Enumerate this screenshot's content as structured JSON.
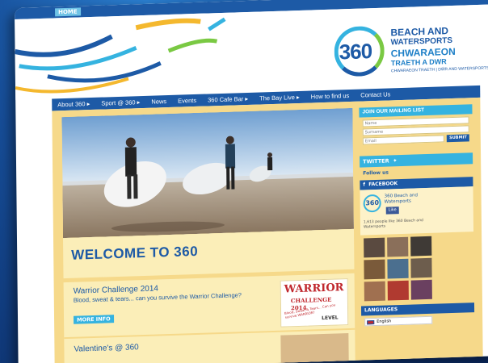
{
  "topbar": {
    "home": "HOME"
  },
  "logo": {
    "number": "360",
    "line1": "BEACH AND",
    "line2": "WATERSPORTS",
    "line3": "CHWARAEON",
    "line4": "TRAETH A DWR",
    "line5": "CHWARAEON TRAETH | DŴR AND WATERSPORTS"
  },
  "nav": {
    "items": [
      "About 360 ▸",
      "Sport @ 360 ▸",
      "News",
      "Events",
      "360 Cafe Bar ▸",
      "The Bay Live ▸",
      "How to find us",
      "Contact Us"
    ]
  },
  "main": {
    "welcome": "WELCOME TO 360",
    "news": [
      {
        "title": "Warrior Challenge 2014",
        "desc": "Blood, sweat & tears... can you survive the Warrior Challenge?",
        "more": "MORE INFO",
        "badge": {
          "title": "WARRIOR",
          "sub": "CHALLENGE 2014",
          "tag": "Blood, Sweat & Tears... Can you survive WARRIOR?",
          "brand": "LEVEL"
        }
      },
      {
        "title": "Valentine's @ 360"
      }
    ]
  },
  "sidebar": {
    "mailing_title": "JOIN OUR MAILING LIST",
    "name_placeholder": "Name",
    "surname_placeholder": "Surname",
    "email_placeholder": "Email",
    "submit": "SUBMIT",
    "twitter": "TWITTER",
    "follow": "Follow us",
    "facebook": "FACEBOOK",
    "fb_name": "360 Beach and Watersports",
    "fb_like": "Like",
    "fb_count": "1,613 people like 360 Beach and Watersports",
    "languages": "LANGUAGES",
    "language_selected": "English"
  },
  "colors": {
    "brand_blue": "#1d5aa6",
    "accent_cyan": "#35b3e0",
    "sand": "#f6d98a",
    "warrior_red": "#c0272d"
  }
}
